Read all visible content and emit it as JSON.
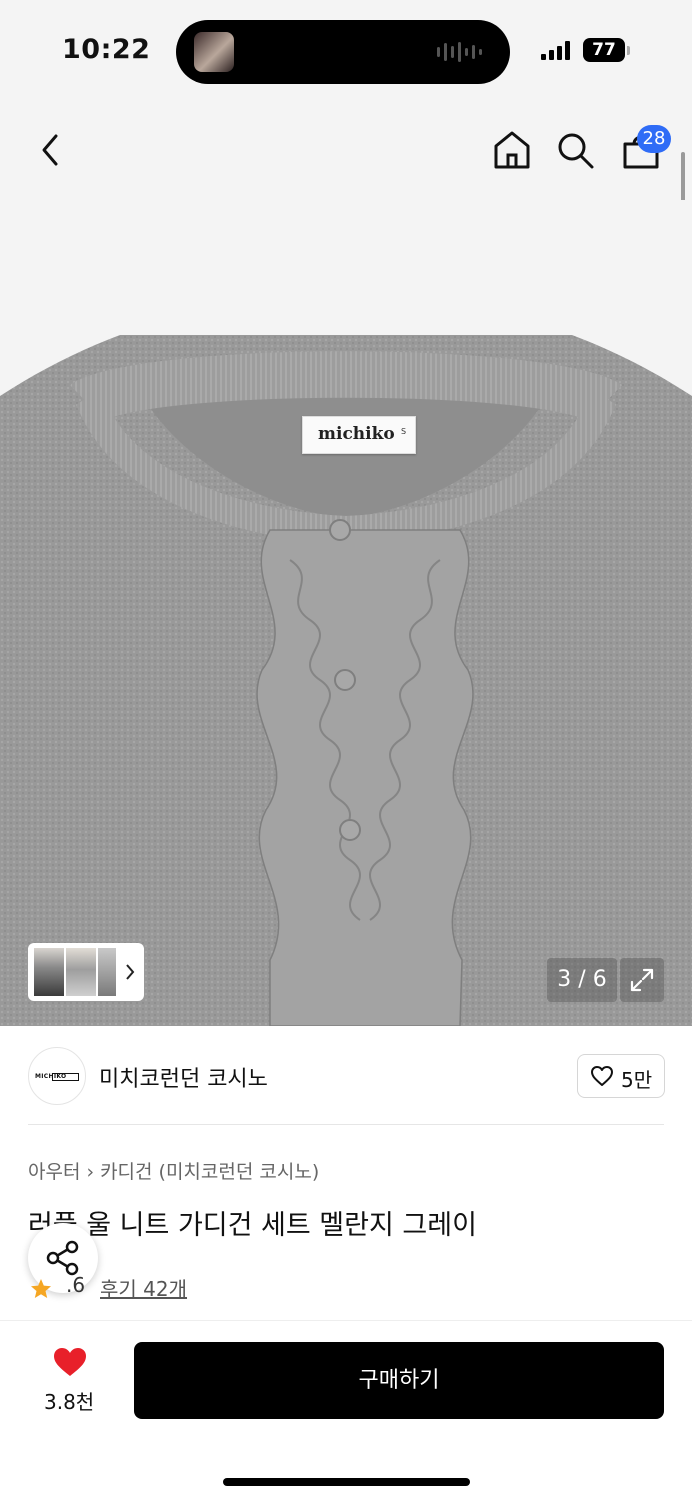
{
  "status_bar": {
    "time": "10:22",
    "battery": "77",
    "island_icons": [
      "now-playing-thumbnail-icon",
      "audio-waveform-icon"
    ]
  },
  "nav": {
    "icons": [
      "back-chevron-icon",
      "home-icon",
      "search-icon",
      "cart-bag-icon"
    ],
    "cart_count": "28"
  },
  "gallery": {
    "counter": "3 / 6",
    "position": 3,
    "total": 6,
    "label_brand": "michiko",
    "label_size": "S"
  },
  "brand": {
    "name": "미치코런던 코시노",
    "likes": "5만"
  },
  "product": {
    "breadcrumb": [
      "아우터",
      "카디건 (미치코런던 코시노)"
    ],
    "title": "러플 울 니트 가디건 세트 멜란지 그레이",
    "rating": ".6",
    "reviews": "후기 42개"
  },
  "bottom": {
    "wish_count": "3.8천",
    "buy_label": "구매하기"
  },
  "colors": {
    "accent_blue": "#2f6cf6",
    "heart_red": "#e8202a",
    "star_yellow": "#f5a623",
    "sweater_gray": "#9b9b9b"
  }
}
